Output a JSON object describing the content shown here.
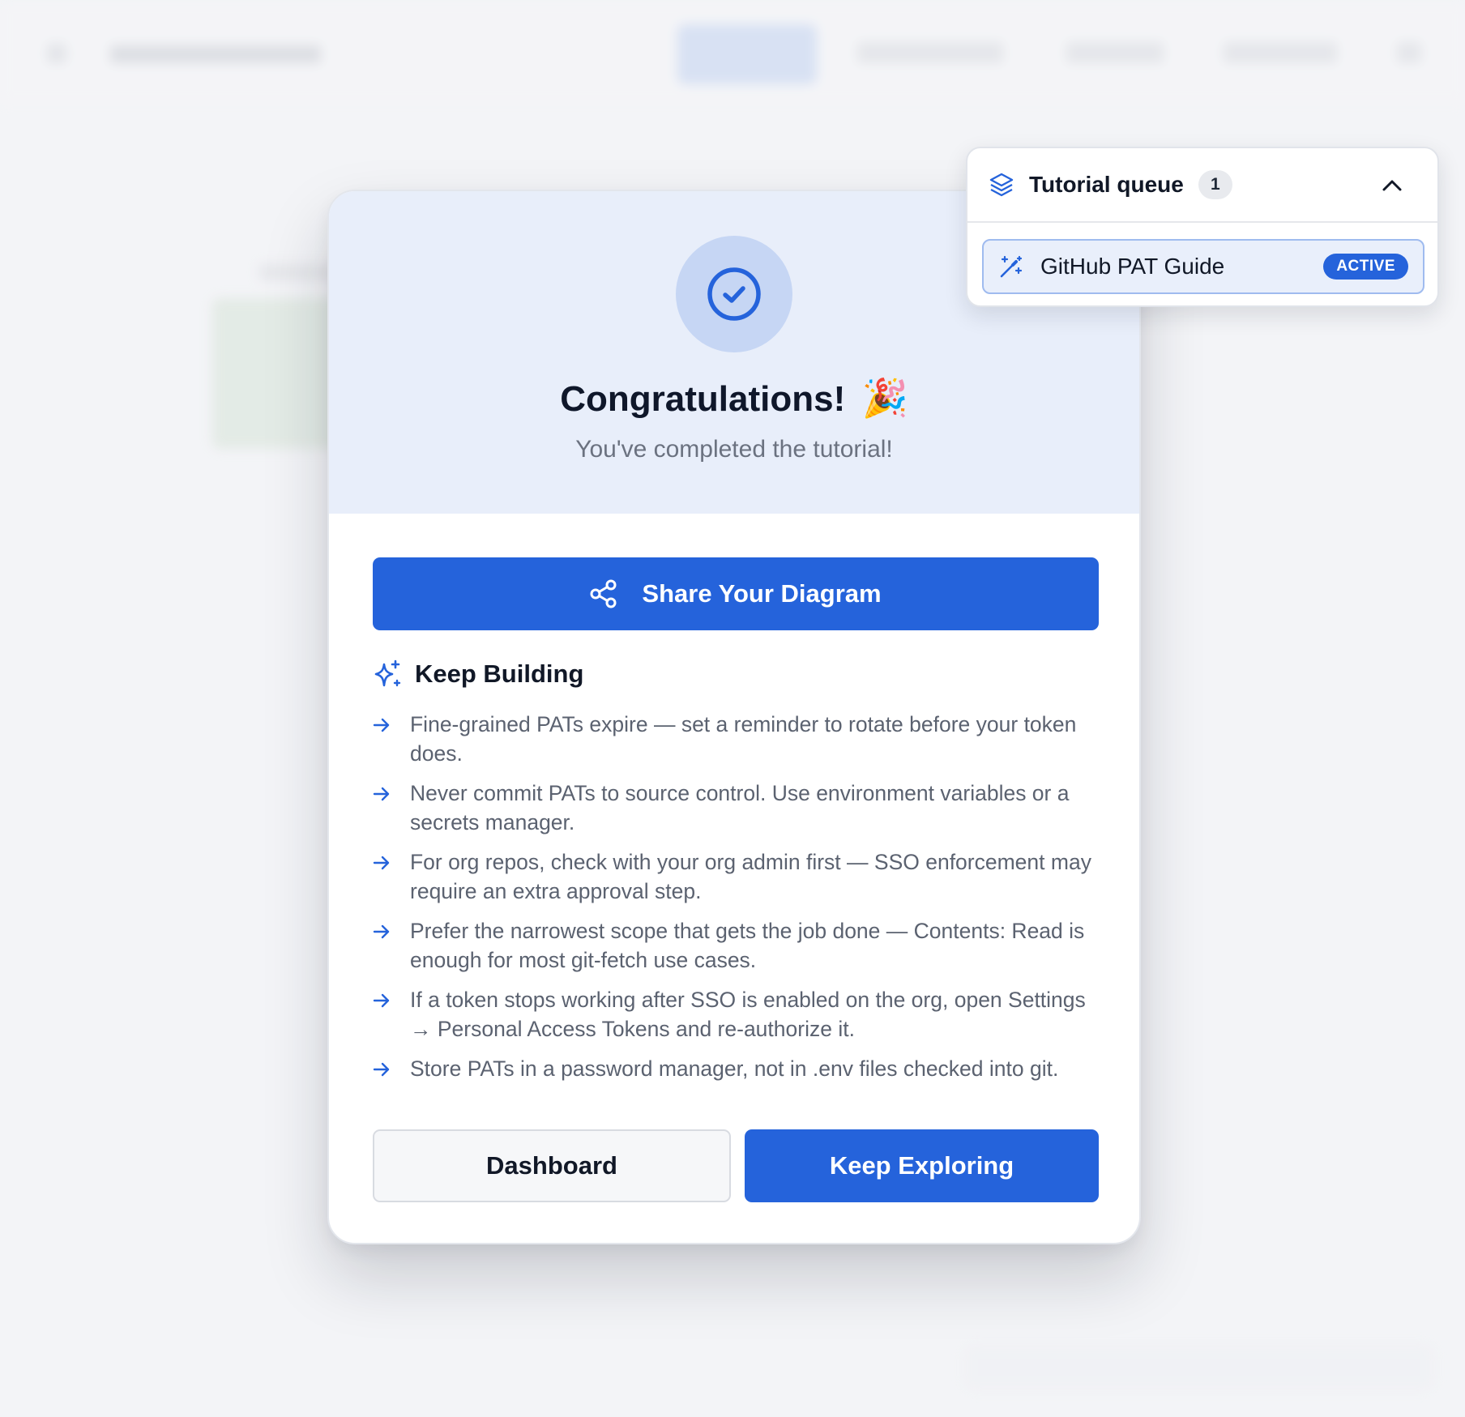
{
  "background": {
    "description_hidden": true
  },
  "modal": {
    "title": "Congratulations!",
    "title_emoji": "🎉",
    "subtitle": "You've completed the tutorial!",
    "share_button_label": "Share Your Diagram",
    "section_heading": "Keep Building",
    "tips": [
      "Fine-grained PATs expire — set a reminder to rotate before your token does.",
      "Never commit PATs to source control. Use environment variables or a secrets manager.",
      "For org repos, check with your org admin first — SSO enforcement may require an extra approval step.",
      "Prefer the narrowest scope that gets the job done — Contents: Read is enough for most git-fetch use cases.",
      "If a token stops working after SSO is enabled on the org, open Settings → Personal Access Tokens and re-authorize it.",
      "Store PATs in a password manager, not in .env files checked into git."
    ],
    "dashboard_button_label": "Dashboard",
    "explore_button_label": "Keep Exploring"
  },
  "tutorial_queue": {
    "title": "Tutorial queue",
    "count": "1",
    "items": [
      {
        "label": "GitHub PAT Guide",
        "status": "ACTIVE"
      }
    ]
  },
  "icons": {
    "check": "check-circle-icon",
    "share": "share-icon",
    "sparkle": "sparkles-icon",
    "arrow": "arrow-right-icon",
    "layers": "layers-icon",
    "chevron": "chevron-up-icon",
    "wand": "magic-wand-icon"
  },
  "colors": {
    "primary": "#2563db",
    "header_bg": "#e8eefa",
    "check_circle_bg": "#c6d6f4",
    "text_muted": "#5b6270"
  }
}
